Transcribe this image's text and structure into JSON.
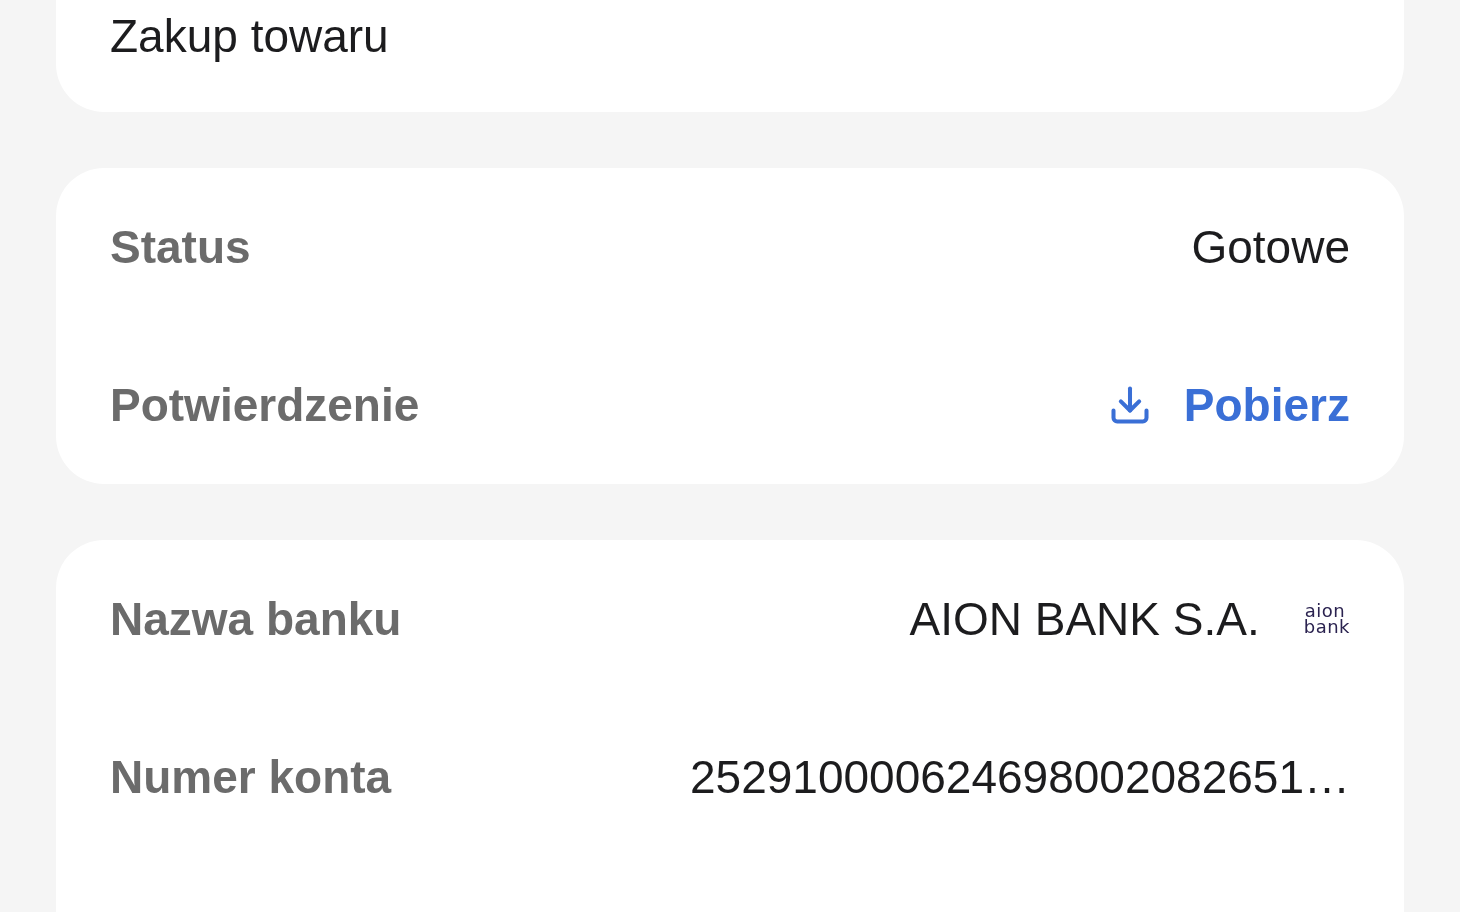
{
  "cards": [
    {
      "title": "Zakup towaru"
    },
    {
      "rows": [
        {
          "kind": "text",
          "label": "Status",
          "value": "Gotowe"
        },
        {
          "kind": "download",
          "label": "Potwierdzenie",
          "value": "Pobierz"
        }
      ]
    },
    {
      "rows": [
        {
          "kind": "bank",
          "label": "Nazwa banku",
          "value": "AION BANK S.A.",
          "logo_text": [
            "aion",
            "bank"
          ]
        },
        {
          "kind": "text",
          "label": "Numer konta",
          "value": "252910000624698002082651…"
        }
      ]
    }
  ]
}
